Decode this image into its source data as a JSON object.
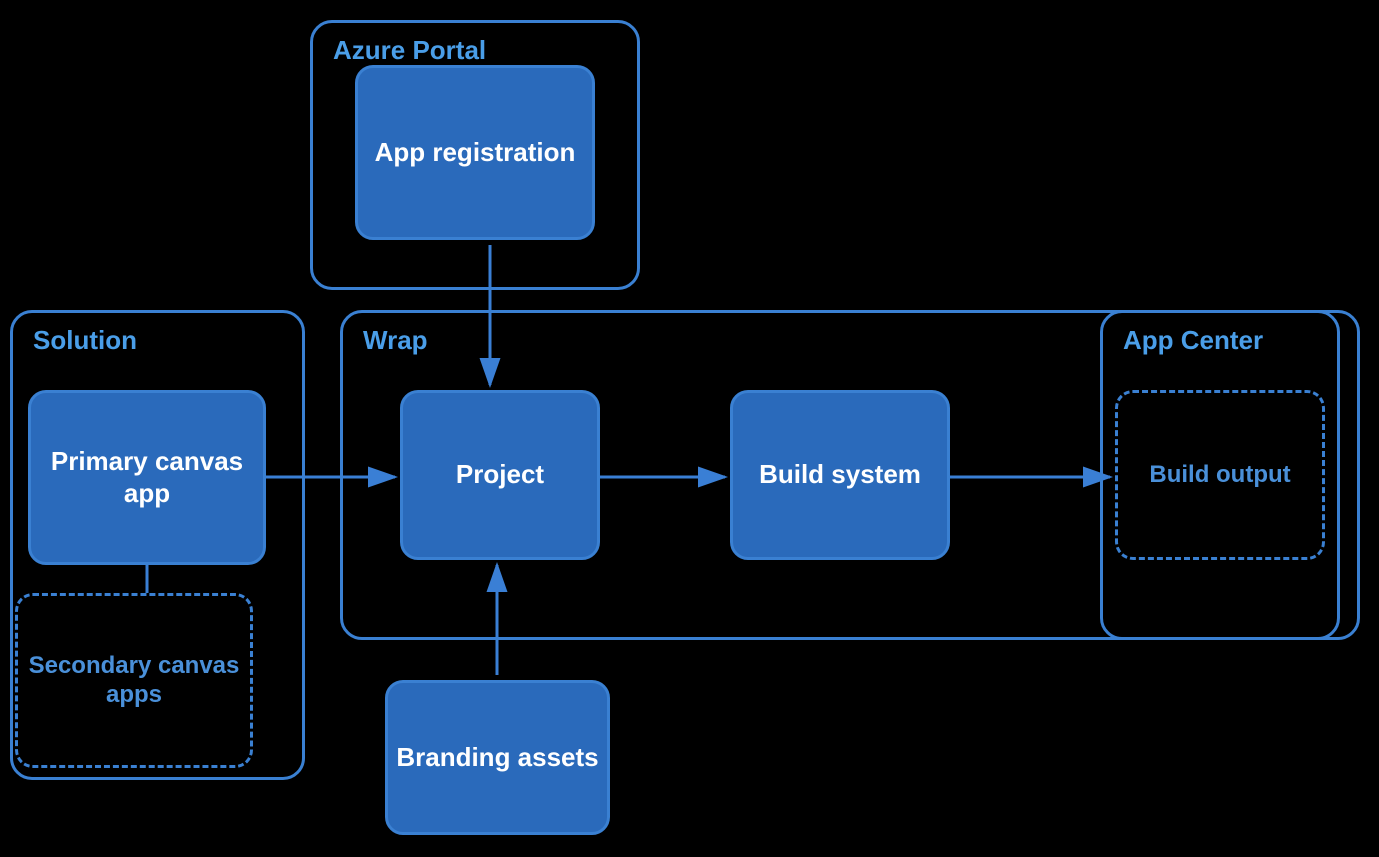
{
  "diagram": {
    "background": "#000000",
    "containers": {
      "azure_portal": {
        "label": "Azure Portal",
        "inner_box": "App registration"
      },
      "solution": {
        "label": "Solution",
        "primary": "Primary canvas app",
        "secondary": "Secondary canvas apps"
      },
      "wrap": {
        "label": "Wrap",
        "project": "Project",
        "build_system": "Build system"
      },
      "app_center": {
        "label": "App Center",
        "build_output": "Build output"
      }
    },
    "standalone": {
      "branding_assets": "Branding assets"
    }
  }
}
